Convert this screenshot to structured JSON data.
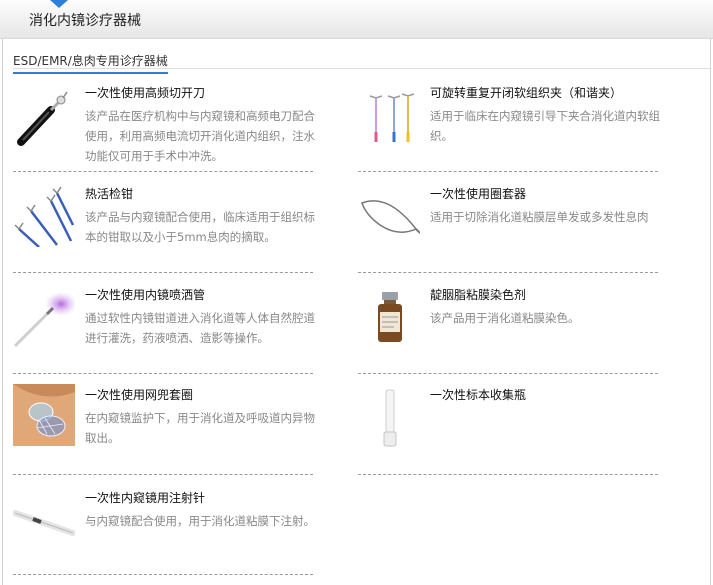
{
  "header": {
    "title": "消化内镜诊疗器械"
  },
  "section": {
    "title": "ESD/EMR/息肉专用诊疗器械"
  },
  "products": [
    {
      "name": "一次性使用高频切开刀",
      "description": "该产品在医疗机构中与内窥镜和高频电刀配合使用，利用高频电流切开消化道内组织，注水功能仅可用于手术中冲洗。",
      "icon": "hf-knife-icon"
    },
    {
      "name": "可旋转重复开闭软组织夹（和谐夹）",
      "description": "适用于临床在内窥镜引导下夹合消化道内软组织。",
      "icon": "clip-icon"
    },
    {
      "name": "热活检钳",
      "description": "该产品与内窥镜配合使用，临床适用于组织标本的钳取以及小于5mm息肉的摘取。",
      "icon": "forceps-icon"
    },
    {
      "name": "一次性使用圈套器",
      "description": "适用于切除消化道粘膜层单发或多发性息肉",
      "icon": "snare-icon"
    },
    {
      "name": "一次性使用内镜喷洒管",
      "description": "通过软性内镜钳道进入消化道等人体自然腔道进行灌洗，药液喷洒、造影等操作。",
      "icon": "spray-tube-icon"
    },
    {
      "name": "靛胭脂粘膜染色剂",
      "description": "该产品用于消化道粘膜染色。",
      "icon": "dye-bottle-icon"
    },
    {
      "name": "一次性使用网兜套圈",
      "description": "在内窥镜监护下，用于消化道及呼吸道内异物取出。",
      "icon": "net-snare-icon"
    },
    {
      "name": "一次性标本收集瓶",
      "description": "",
      "icon": "specimen-bottle-icon"
    },
    {
      "name": "一次性内窥镜用注射针",
      "description": "与内窥镜配合使用，用于消化道粘膜下注射。",
      "icon": "injection-needle-icon"
    }
  ],
  "colors": {
    "accent": "#2d7ed8",
    "description_text": "#888888",
    "divider": "#9a9a9a"
  }
}
